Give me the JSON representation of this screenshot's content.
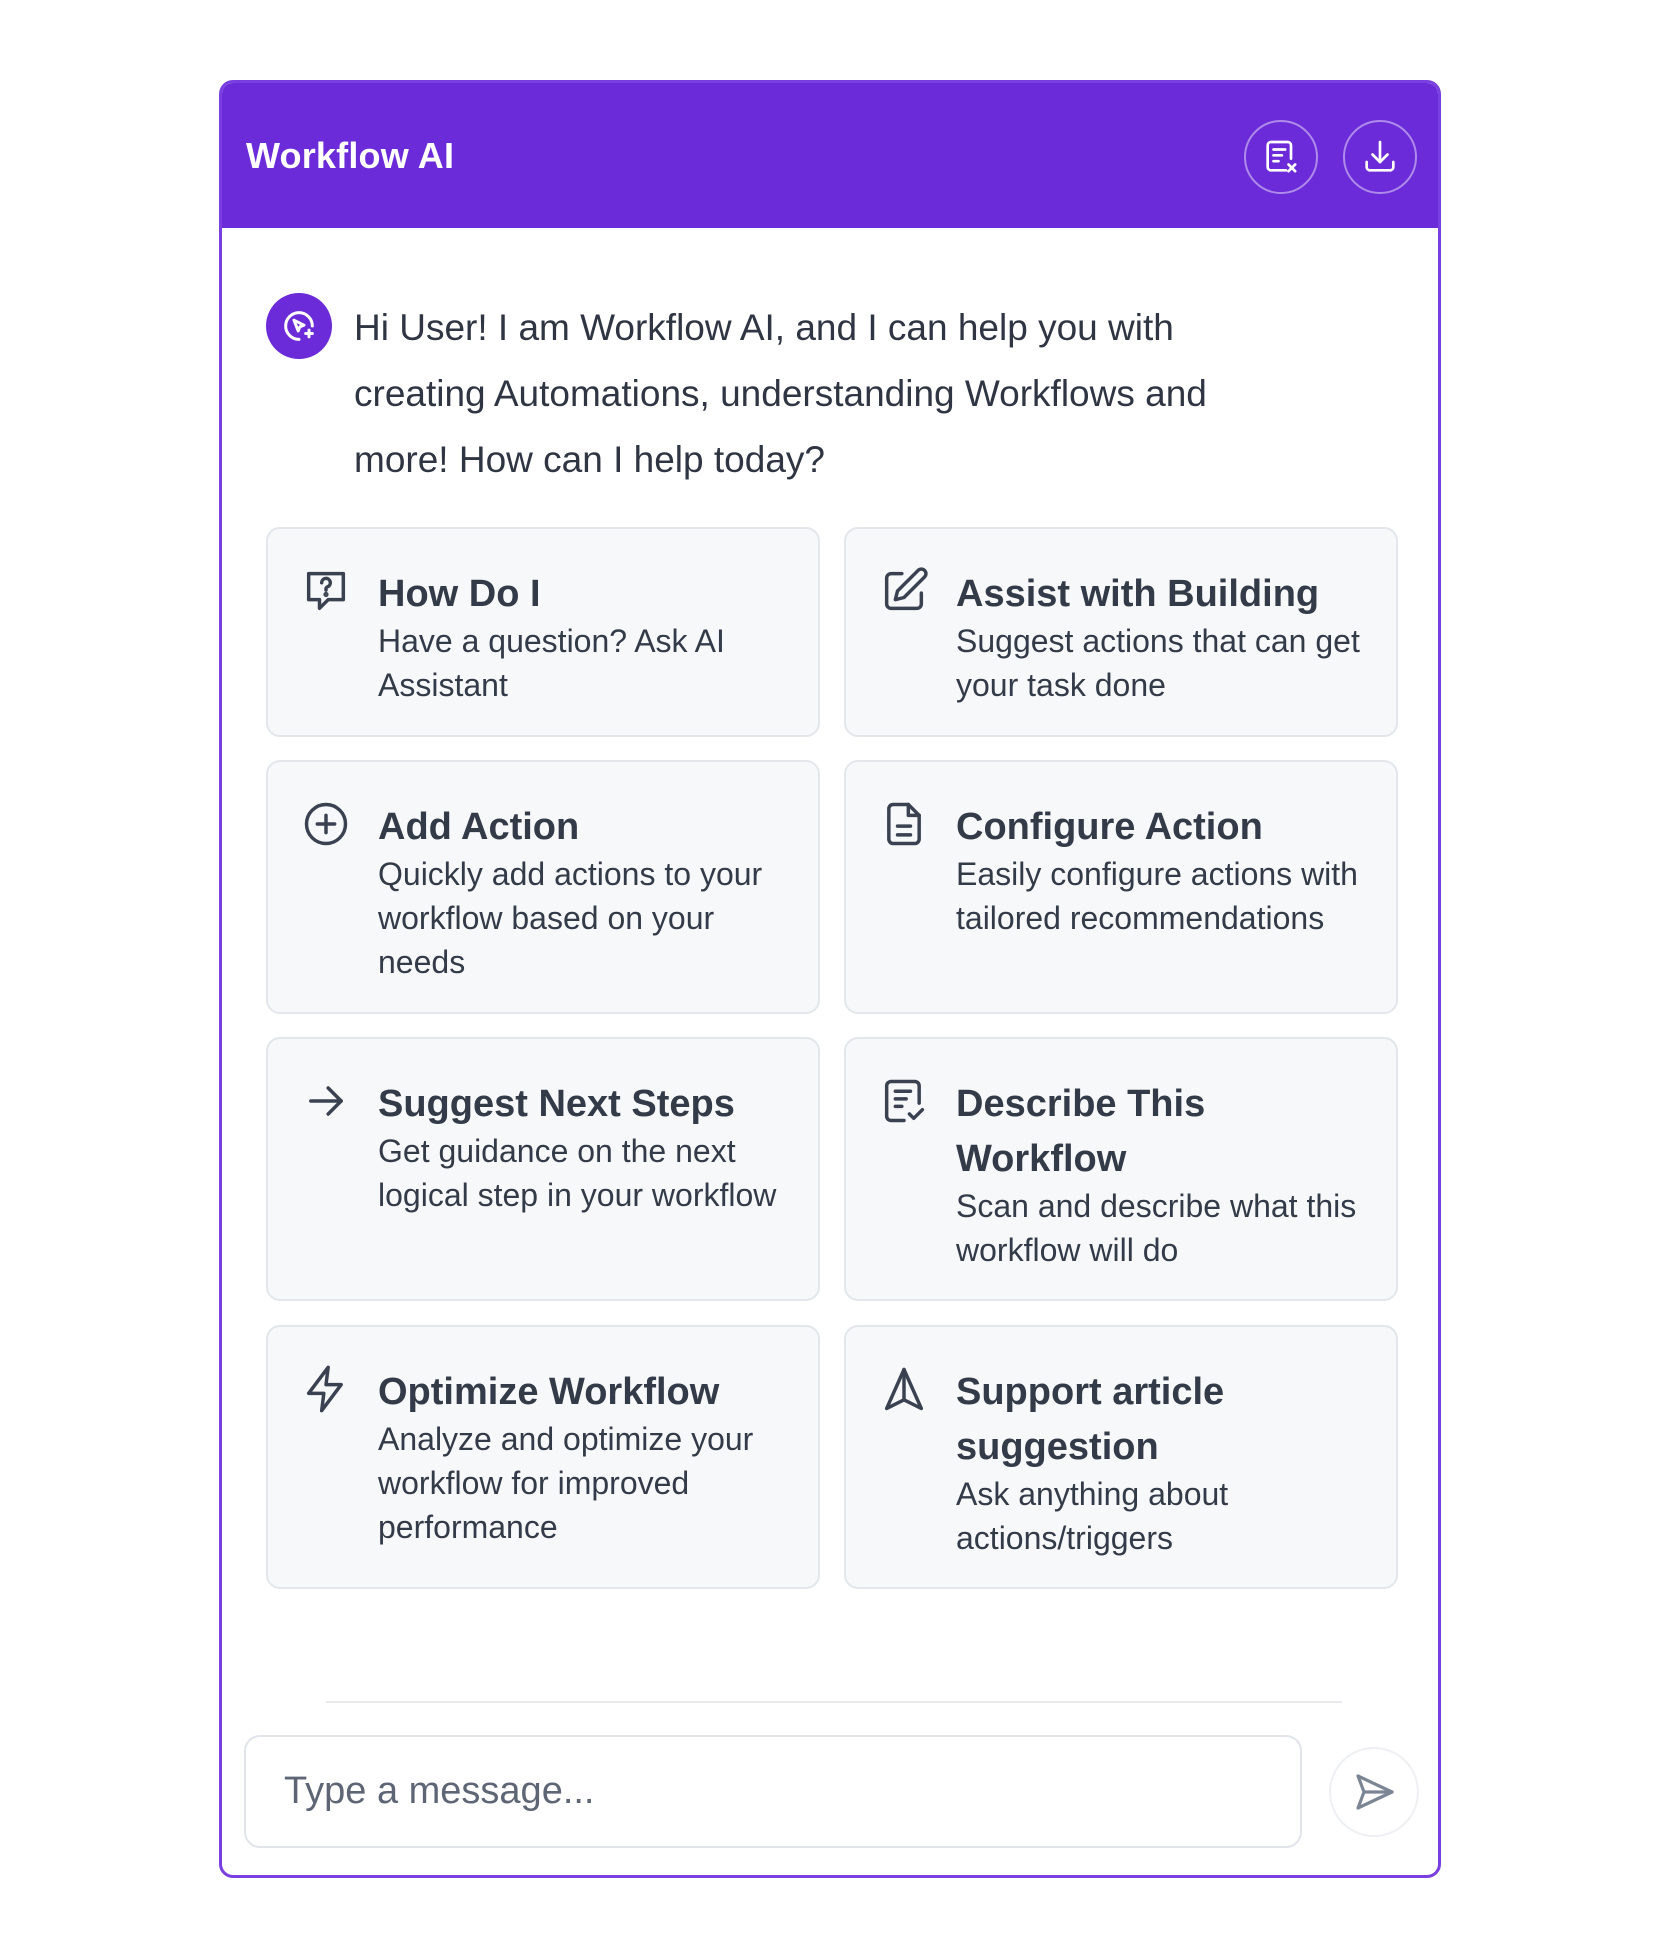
{
  "header": {
    "title": "Workflow AI",
    "clear_chat_icon": "clear-chat-icon",
    "download_icon": "download-icon"
  },
  "greeting": {
    "avatar_icon": "ai-assistant-icon",
    "message": "Hi User! I am Workflow AI, and I can help you with creating Automations, understanding Workflows and more! How can I help today?"
  },
  "cards": [
    {
      "icon": "question-chat-icon",
      "title": "How Do I",
      "description": "Have a question? Ask AI Assistant"
    },
    {
      "icon": "edit-icon",
      "title": "Assist with Building",
      "description": "Suggest actions that can get your task done"
    },
    {
      "icon": "plus-circle-icon",
      "title": "Add Action",
      "description": "Quickly add actions to your workflow based on your needs"
    },
    {
      "icon": "document-icon",
      "title": "Configure Action",
      "description": "Easily configure actions with tailored recommendations"
    },
    {
      "icon": "arrow-right-icon",
      "title": "Suggest Next Steps",
      "description": "Get guidance on the next logical step in your workflow"
    },
    {
      "icon": "document-check-icon",
      "title": "Describe This Workflow",
      "description": "Scan and describe what this workflow will do"
    },
    {
      "icon": "lightning-icon",
      "title": "Optimize Workflow",
      "description": "Analyze and optimize your workflow for improved performance"
    },
    {
      "icon": "compass-icon",
      "title": "Support article suggestion",
      "description": "Ask anything about actions/triggers"
    }
  ],
  "composer": {
    "placeholder": "Type a message...",
    "value": "",
    "send_icon": "send-icon"
  },
  "colors": {
    "brand": "#6c2bd9",
    "card_background": "#f7f8fa",
    "text": "#343b48"
  }
}
